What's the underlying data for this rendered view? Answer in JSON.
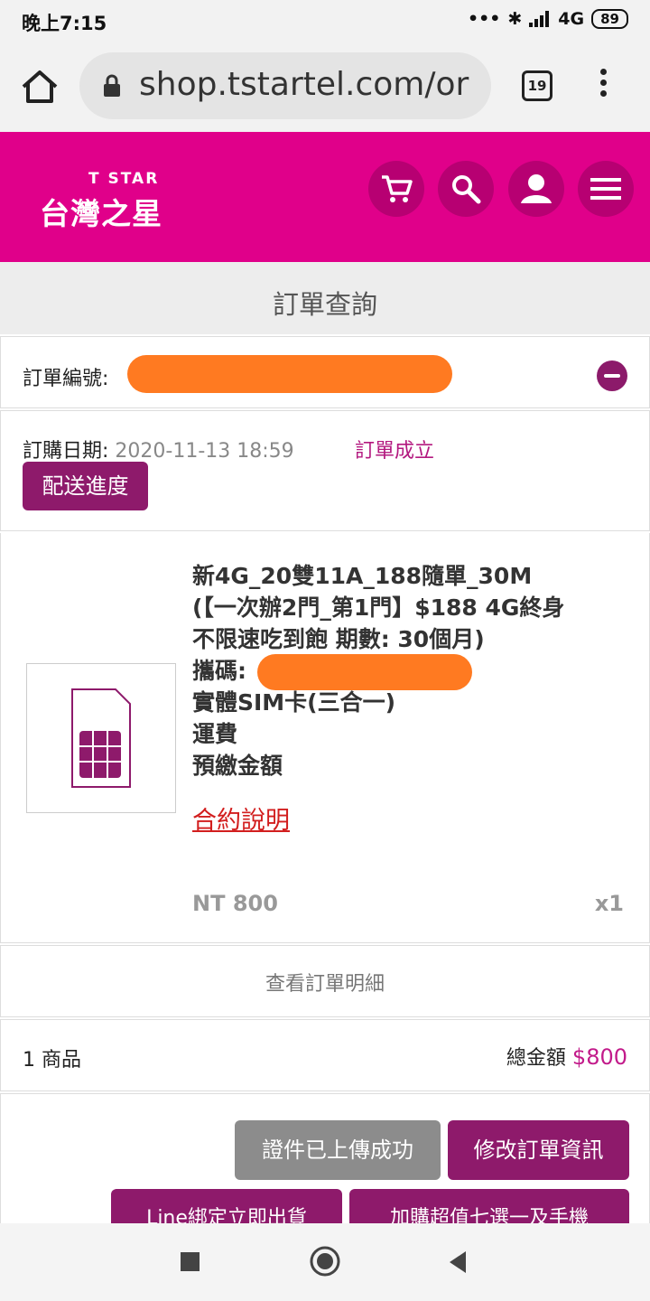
{
  "status_bar": {
    "time": "晚上7:15",
    "network": "4G",
    "battery": "89"
  },
  "browser": {
    "url": "shop.tstartel.com/or",
    "tab_count": "19"
  },
  "brand": {
    "logo_en": "T STAR",
    "logo_cn": "台灣之星",
    "color": "#e0008a"
  },
  "header_icons": [
    "cart-icon",
    "search-icon",
    "user-icon",
    "menu-icon"
  ],
  "page_title": "訂單查詢",
  "order": {
    "number_label": "訂單編號:",
    "date_label": "訂購日期:",
    "date_value": "2020-11-13 18:59",
    "status": "訂單成立",
    "delivery_button": "配送進度"
  },
  "product": {
    "lines": [
      "新4G_20雙11A_188隨單_30M",
      "(【一次辦2門_第1門】$188 4G終身",
      "不限速吃到飽 期數: 30個月)",
      "攜碼:",
      "實體SIM卡(三合一)",
      "運費",
      "預繳金額"
    ],
    "contract_link": "合約說明",
    "price": "NT 800",
    "quantity": "x1"
  },
  "view_details": "查看訂單明細",
  "summary": {
    "items": "1 商品",
    "total_label": "總金額",
    "total_value": "$800"
  },
  "actions": {
    "docs_uploaded": "證件已上傳成功",
    "edit_order": "修改訂單資訊",
    "line_bind": "Line綁定立即出貨",
    "addon_offer": "加購超值七選一及手機"
  },
  "nav_icons": [
    "recents-square-icon",
    "home-circle-icon",
    "back-triangle-icon"
  ]
}
